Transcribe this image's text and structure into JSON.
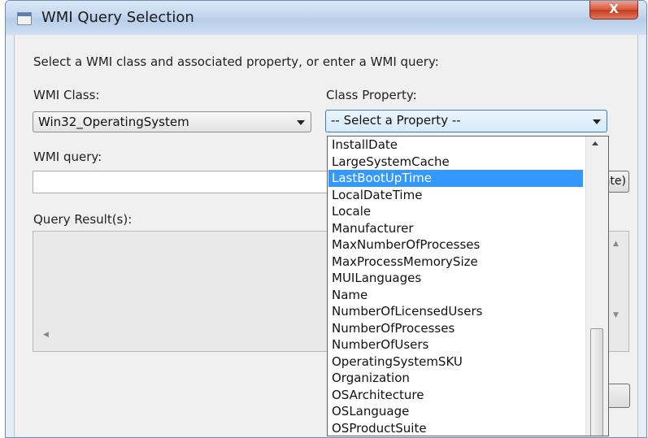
{
  "window": {
    "title": "WMI Query Selection",
    "close_label": "X"
  },
  "instructions": "Select a WMI class and associated property, or enter a WMI query:",
  "wmi_class": {
    "label": "WMI Class:",
    "value": "Win32_OperatingSystem"
  },
  "class_property": {
    "label": "Class Property:",
    "value": "-- Select a Property --",
    "options": [
      "InstallDate",
      "LargeSystemCache",
      "LastBootUpTime",
      "LocalDateTime",
      "Locale",
      "Manufacturer",
      "MaxNumberOfProcesses",
      "MaxProcessMemorySize",
      "MUILanguages",
      "Name",
      "NumberOfLicensedUsers",
      "NumberOfProcesses",
      "NumberOfUsers",
      "OperatingSystemSKU",
      "Organization",
      "OSArchitecture",
      "OSLanguage",
      "OSProductSuite"
    ],
    "highlighted_option": "LastBootUpTime"
  },
  "wmi_query": {
    "label": "WMI query:",
    "value": "",
    "button_label": "ate)"
  },
  "query_results": {
    "label": "Query Result(s):"
  }
}
